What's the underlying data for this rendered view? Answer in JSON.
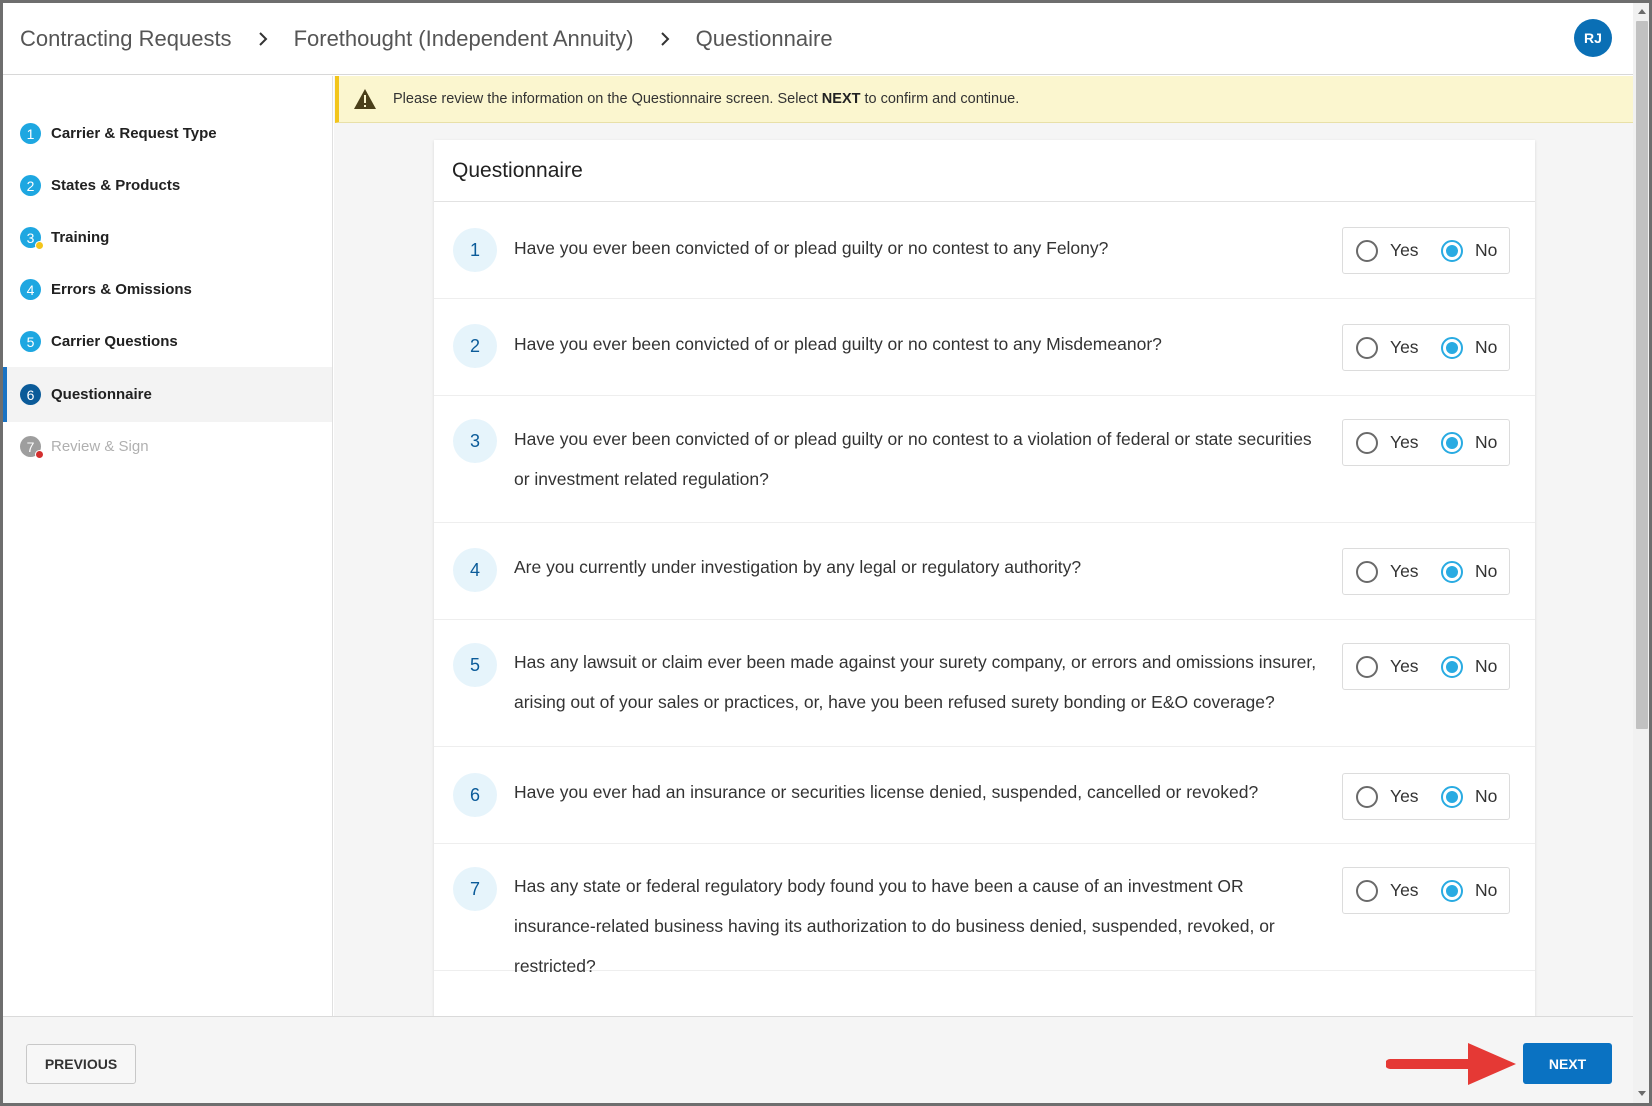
{
  "breadcrumb": {
    "items": [
      "Contracting Requests",
      "Forethought (Independent Annuity)",
      "Questionnaire"
    ]
  },
  "user": {
    "initials": "RJ"
  },
  "sidebar": {
    "steps": [
      {
        "num": "1",
        "label": "Carrier & Request Type",
        "state": "complete"
      },
      {
        "num": "2",
        "label": "States & Products",
        "state": "complete"
      },
      {
        "num": "3",
        "label": "Training",
        "state": "warning"
      },
      {
        "num": "4",
        "label": "Errors & Omissions",
        "state": "complete"
      },
      {
        "num": "5",
        "label": "Carrier Questions",
        "state": "complete"
      },
      {
        "num": "6",
        "label": "Questionnaire",
        "state": "active"
      },
      {
        "num": "7",
        "label": "Review & Sign",
        "state": "error-disabled"
      }
    ]
  },
  "alert": {
    "text_before": "Please review the information on the Questionnaire screen. Select ",
    "bold": "NEXT",
    "text_after": " to confirm and continue."
  },
  "questionnaire": {
    "title": "Questionnaire",
    "yes_label": "Yes",
    "no_label": "No",
    "questions": [
      {
        "num": "1",
        "text": "Have you ever been convicted of or plead guilty or no contest to any Felony?",
        "answer": "No"
      },
      {
        "num": "2",
        "text": "Have you ever been convicted of or plead guilty or no contest to any Misdemeanor?",
        "answer": "No"
      },
      {
        "num": "3",
        "text": "Have you ever been convicted of or plead guilty or no contest to a violation of federal or state securities or investment related regulation?",
        "answer": "No"
      },
      {
        "num": "4",
        "text": "Are you currently under investigation by any legal or regulatory authority?",
        "answer": "No"
      },
      {
        "num": "5",
        "text": "Has any lawsuit or claim ever been made against your surety company, or errors and omissions insurer, arising out of your sales or practices, or, have you been refused surety bonding or E&O coverage?",
        "answer": "No"
      },
      {
        "num": "6",
        "text": "Have you ever had an insurance or securities license denied, suspended, cancelled or revoked?",
        "answer": "No"
      },
      {
        "num": "7",
        "text": "Has any state or federal regulatory body found you to have been a cause of an investment OR insurance-related business having its authorization to do business denied, suspended, revoked, or restricted?",
        "answer": "No"
      }
    ]
  },
  "footer": {
    "previous_label": "PREVIOUS",
    "next_label": "NEXT"
  },
  "colors": {
    "accent": "#1ea7e1",
    "active_step": "#0b5b99",
    "next_button": "#0a72c2",
    "alert_bg": "#fbf6cf",
    "radio_checked": "#29abe2",
    "annotation_arrow": "#e53935",
    "warning_dot": "#f3c51b",
    "error_dot": "#d32f2f"
  }
}
